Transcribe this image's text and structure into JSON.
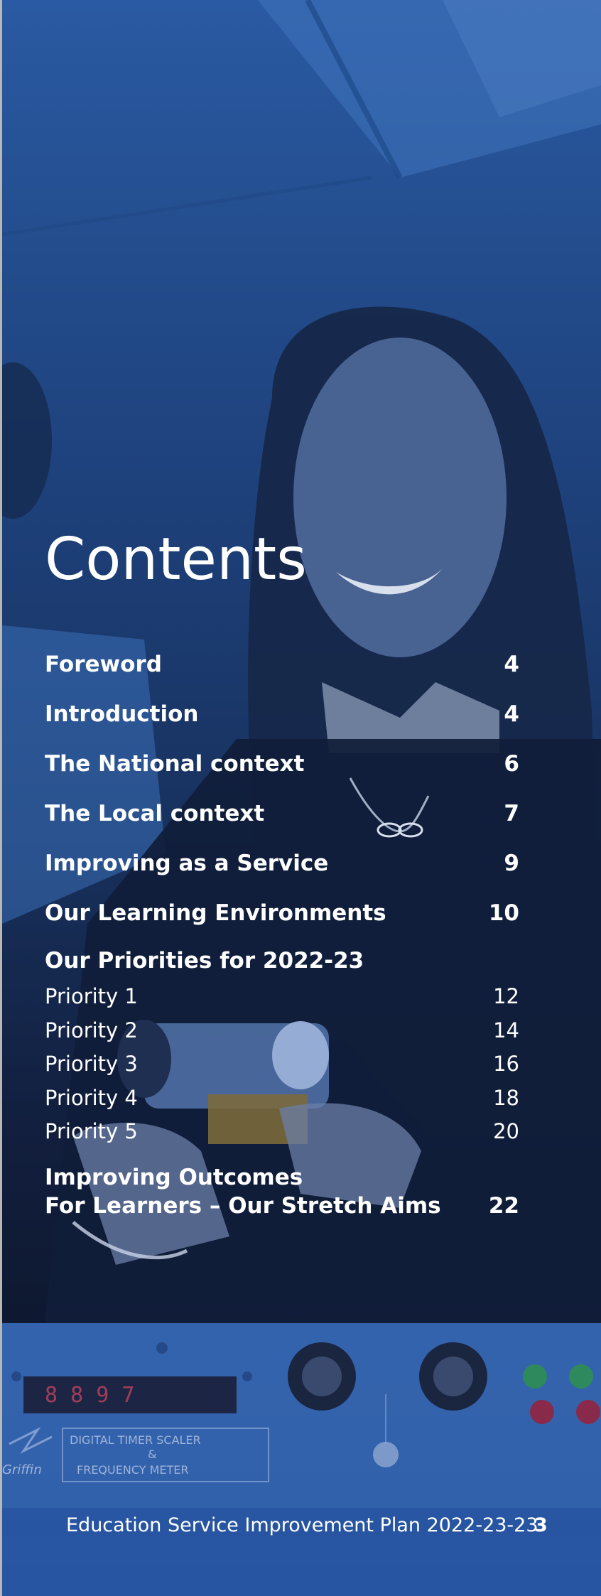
{
  "document": {
    "heading": "Contents",
    "footer_title": "Education Service Improvement Plan 2022-23-23",
    "footer_page": "3"
  },
  "toc": {
    "main_entries": [
      {
        "label": "Foreword",
        "page": "4"
      },
      {
        "label": "Introduction",
        "page": "4"
      },
      {
        "label": "The National context",
        "page": "6"
      },
      {
        "label": "The Local context",
        "page": "7"
      },
      {
        "label": "Improving as a Service",
        "page": "9"
      },
      {
        "label": "Our Learning Environments",
        "page": "10"
      }
    ],
    "priorities_heading": "Our Priorities for 2022-23",
    "priorities": [
      {
        "label": "Priority 1",
        "page": "12"
      },
      {
        "label": "Priority 2",
        "page": "14"
      },
      {
        "label": "Priority 3",
        "page": "16"
      },
      {
        "label": "Priority 4",
        "page": "18"
      },
      {
        "label": "Priority 5",
        "page": "20"
      }
    ],
    "final_entry": {
      "line1": "Improving Outcomes",
      "line2": "For Learners – Our Stretch Aims",
      "page": "22"
    }
  },
  "equipment_panel": {
    "display_readout": "8 8 9 7",
    "panel_label_line1": "DIGITAL TIMER SCALER",
    "panel_label_line2": "&",
    "panel_label_line3": "FREQUENCY METER",
    "brand": "Griffin"
  },
  "colors": {
    "overlay_blue": "#2a58a3",
    "text": "#ffffff"
  }
}
